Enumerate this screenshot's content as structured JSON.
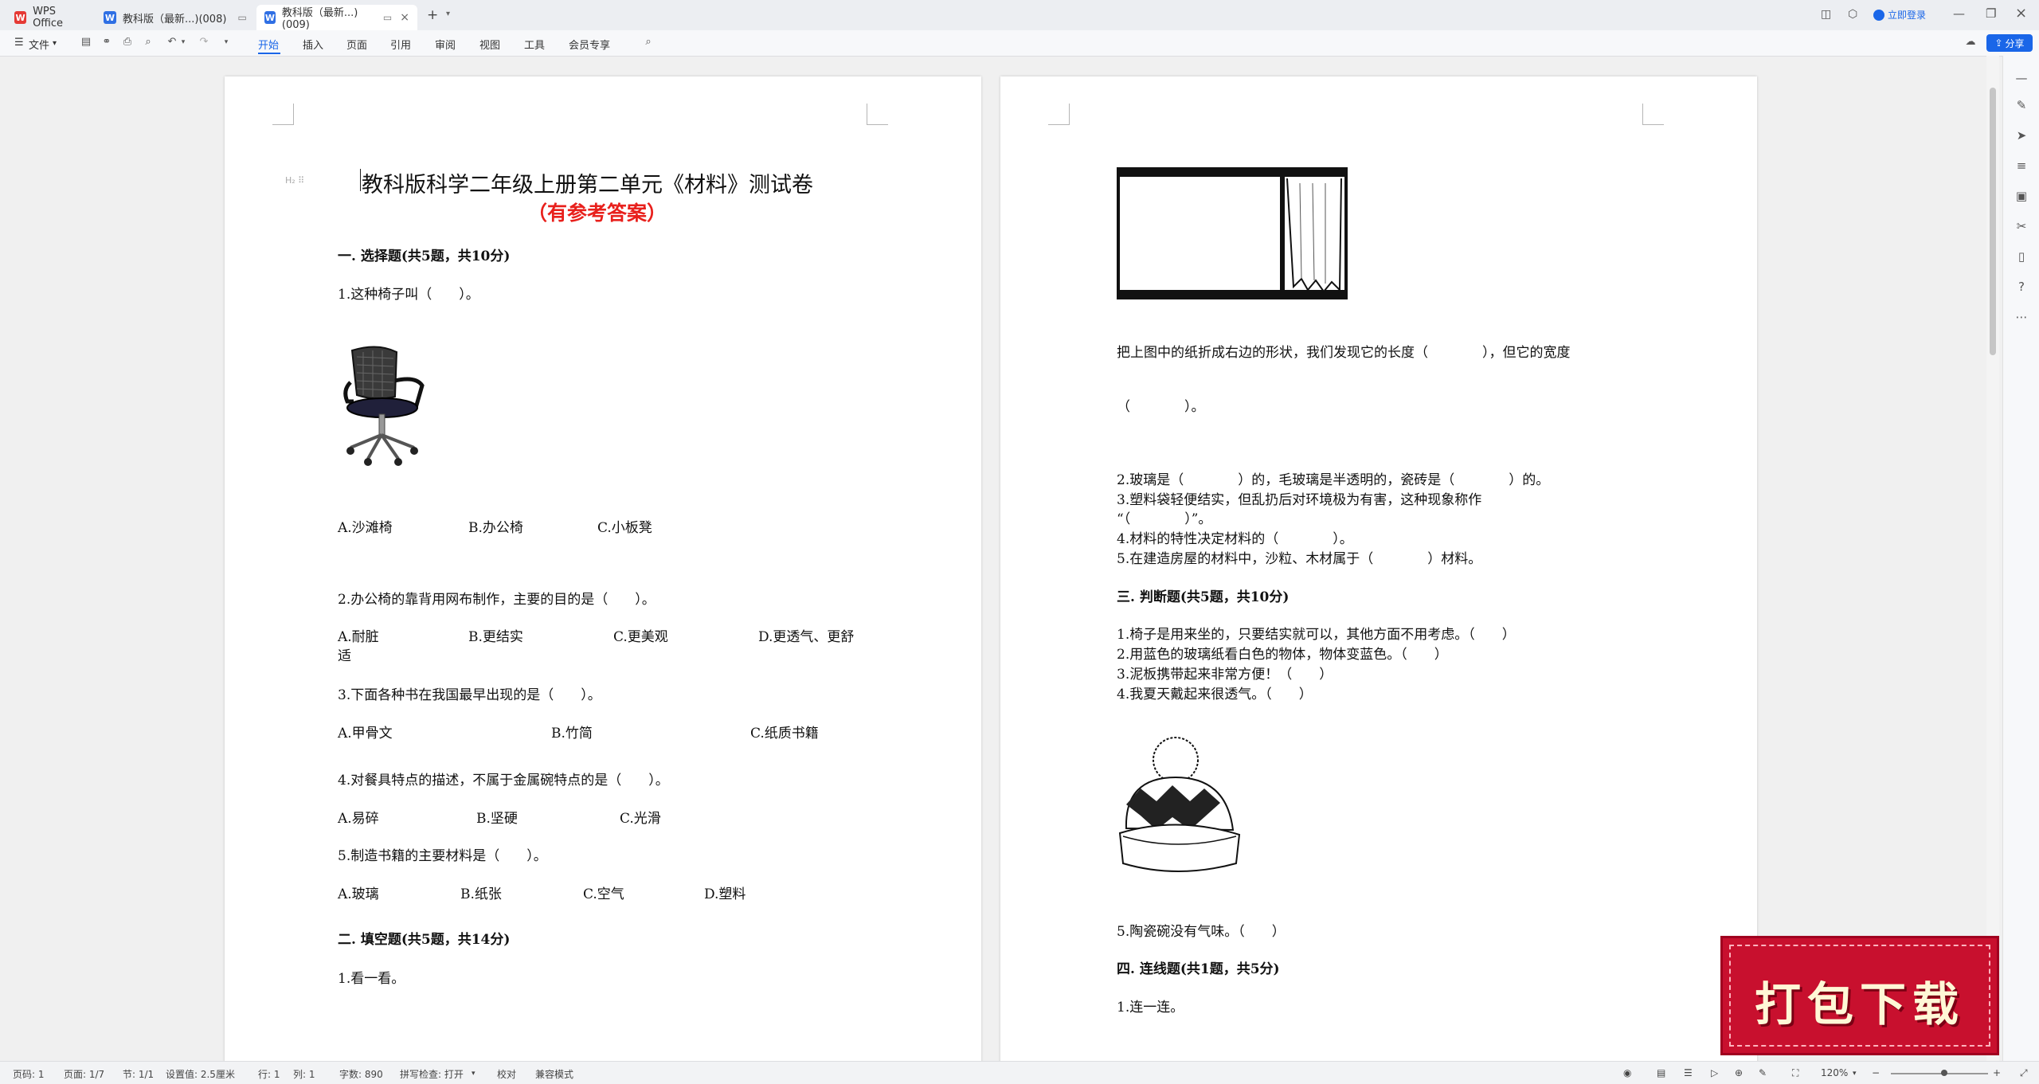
{
  "titlebar": {
    "tabs": [
      {
        "label": "WPS Office"
      },
      {
        "label": "教科版（最新...)(008)"
      },
      {
        "label": "教科版（最新...)(009)"
      }
    ],
    "login_label": "立即登录"
  },
  "ribbon": {
    "file_label": "文件",
    "tabs": [
      "开始",
      "插入",
      "页面",
      "引用",
      "审阅",
      "视图",
      "工具",
      "会员专享"
    ],
    "share_label": "分享"
  },
  "left_page": {
    "title": "教科版科学二年级上册第二单元《材料》测试卷",
    "subtitle": "（有参考答案）",
    "sec1": "一. 选择题(共5题，共10分)",
    "q1": "1.这种椅子叫（　　）。",
    "q1_opts": [
      "A.沙滩椅",
      "B.办公椅",
      "C.小板凳"
    ],
    "q2": "2.办公椅的靠背用网布制作，主要的目的是（　　）。",
    "q2_opts": [
      "A.耐脏",
      "B.更结实",
      "C.更美观",
      "D.更透气、更舒"
    ],
    "q2_wrap": "适",
    "q3": "3.下面各种书在我国最早出现的是（　　）。",
    "q3_opts": [
      "A.甲骨文",
      "B.竹简",
      "C.纸质书籍"
    ],
    "q4": "4.对餐具特点的描述，不属于金属碗特点的是（　　）。",
    "q4_opts": [
      "A.易碎",
      "B.坚硬",
      "C.光滑"
    ],
    "q5": "5.制造书籍的主要材料是（　　）。",
    "q5_opts": [
      "A.玻璃",
      "B.纸张",
      "C.空气",
      "D.塑料"
    ],
    "sec2": "二. 填空题(共5题，共14分)",
    "f1": "1.看一看。"
  },
  "right_page": {
    "fold_text_1": "把上图中的纸折成右边的形状，我们发现它的长度（　　　　），但它的宽度",
    "fold_text_2": "（　　　　）。",
    "f2": "2.玻璃是（　　　　）的，毛玻璃是半透明的，瓷砖是（　　　　）的。",
    "f3a": "3.塑料袋轻便结实，但乱扔后对环境极为有害，这种现象称作",
    "f3b": "“（　　　　）”。",
    "f4": "4.材料的特性决定材料的（　　　　）。",
    "f5": "5.在建造房屋的材料中，沙粒、木材属于（　　　　）材料。",
    "sec3": "三. 判断题(共5题，共10分)",
    "j1": "1.椅子是用来坐的，只要结实就可以，其他方面不用考虑。（　　）",
    "j2": "2.用蓝色的玻璃纸看白色的物体，物体变蓝色。（　　）",
    "j3": "3.泥板携带起来非常方便！（　　）",
    "j4": "4.我夏天戴起来很透气。（　　）",
    "j5": "5.陶瓷碗没有气味。（　　）",
    "sec4": "四. 连线题(共1题，共5分)",
    "l1": "1.连一连。"
  },
  "status": {
    "page_num": "页码: 1",
    "pages": "页面: 1/7",
    "section": "节: 1/1",
    "setting": "设置值: 2.5厘米",
    "row": "行: 1",
    "col": "列: 1",
    "words": "字数: 890",
    "spell": "拼写检查: 打开",
    "proof": "校对",
    "compat": "兼容模式",
    "zoom": "120%",
    "zoom_level": 0.55
  },
  "banner": {
    "text": "打包下载"
  },
  "colors": {
    "accent": "#1a66e8",
    "subtitle_red": "#e8201c",
    "banner_red": "#c8102e"
  }
}
